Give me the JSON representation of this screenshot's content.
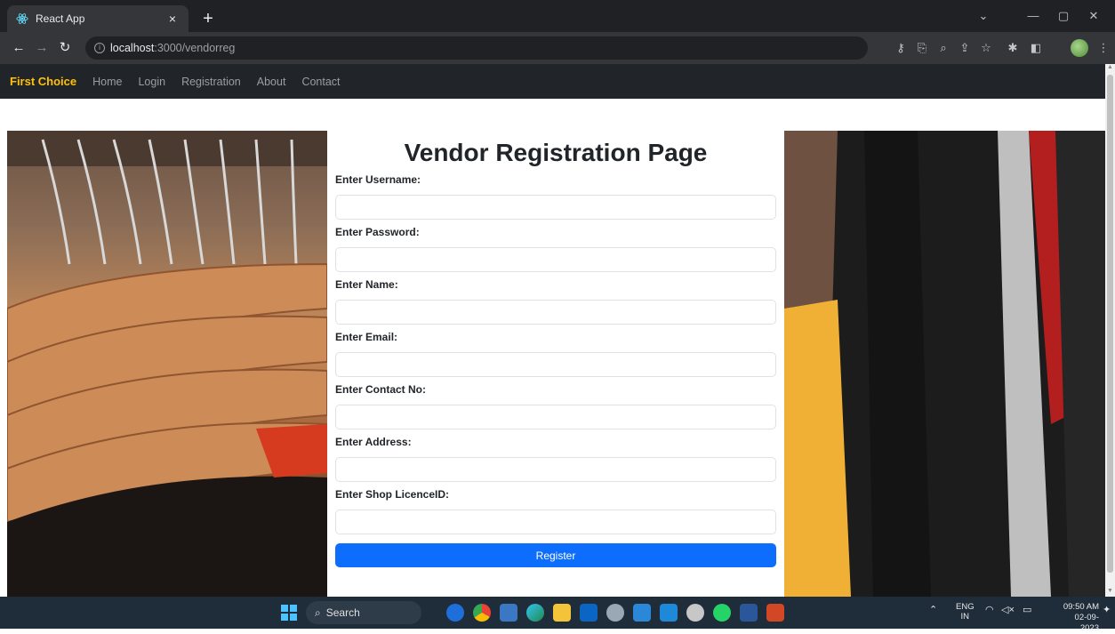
{
  "browser": {
    "tab_title": "React App",
    "tab_close": "×",
    "new_tab": "+",
    "url_host": "localhost",
    "url_path": ":3000/vendorreg",
    "window_controls": {
      "minimize": "—",
      "restore": "▢",
      "close": "✕",
      "tabsearch": "⌄"
    }
  },
  "site": {
    "brand": "First Choice",
    "nav_links": [
      "Home",
      "Login",
      "Registration",
      "About",
      "Contact"
    ]
  },
  "form": {
    "title": "Vendor Registration Page",
    "fields": [
      {
        "label": "Enter Username:",
        "value": ""
      },
      {
        "label": "Enter Password:",
        "value": ""
      },
      {
        "label": "Enter Name:",
        "value": ""
      },
      {
        "label": "Enter Email:",
        "value": ""
      },
      {
        "label": "Enter Contact No:",
        "value": ""
      },
      {
        "label": "Enter Address:",
        "value": ""
      },
      {
        "label": "Enter Shop LicenceID:",
        "value": ""
      }
    ],
    "submit_label": "Register"
  },
  "taskbar": {
    "search_label": "Search",
    "language": "ENG",
    "region": "IN",
    "time": "09:50 AM",
    "date": "02-09-2023",
    "apps": [
      "copilot-icon",
      "chrome-icon",
      "store-icon",
      "edge-icon",
      "explorer-icon",
      "linkedin-icon",
      "settings-icon",
      "devices-icon",
      "vscode-icon",
      "gear-icon",
      "whatsapp-icon",
      "word-icon",
      "powerpoint-icon"
    ]
  },
  "colors": {
    "navbar_bg": "#212529",
    "brand": "#ffc107",
    "button_bg": "#0d6efd"
  }
}
